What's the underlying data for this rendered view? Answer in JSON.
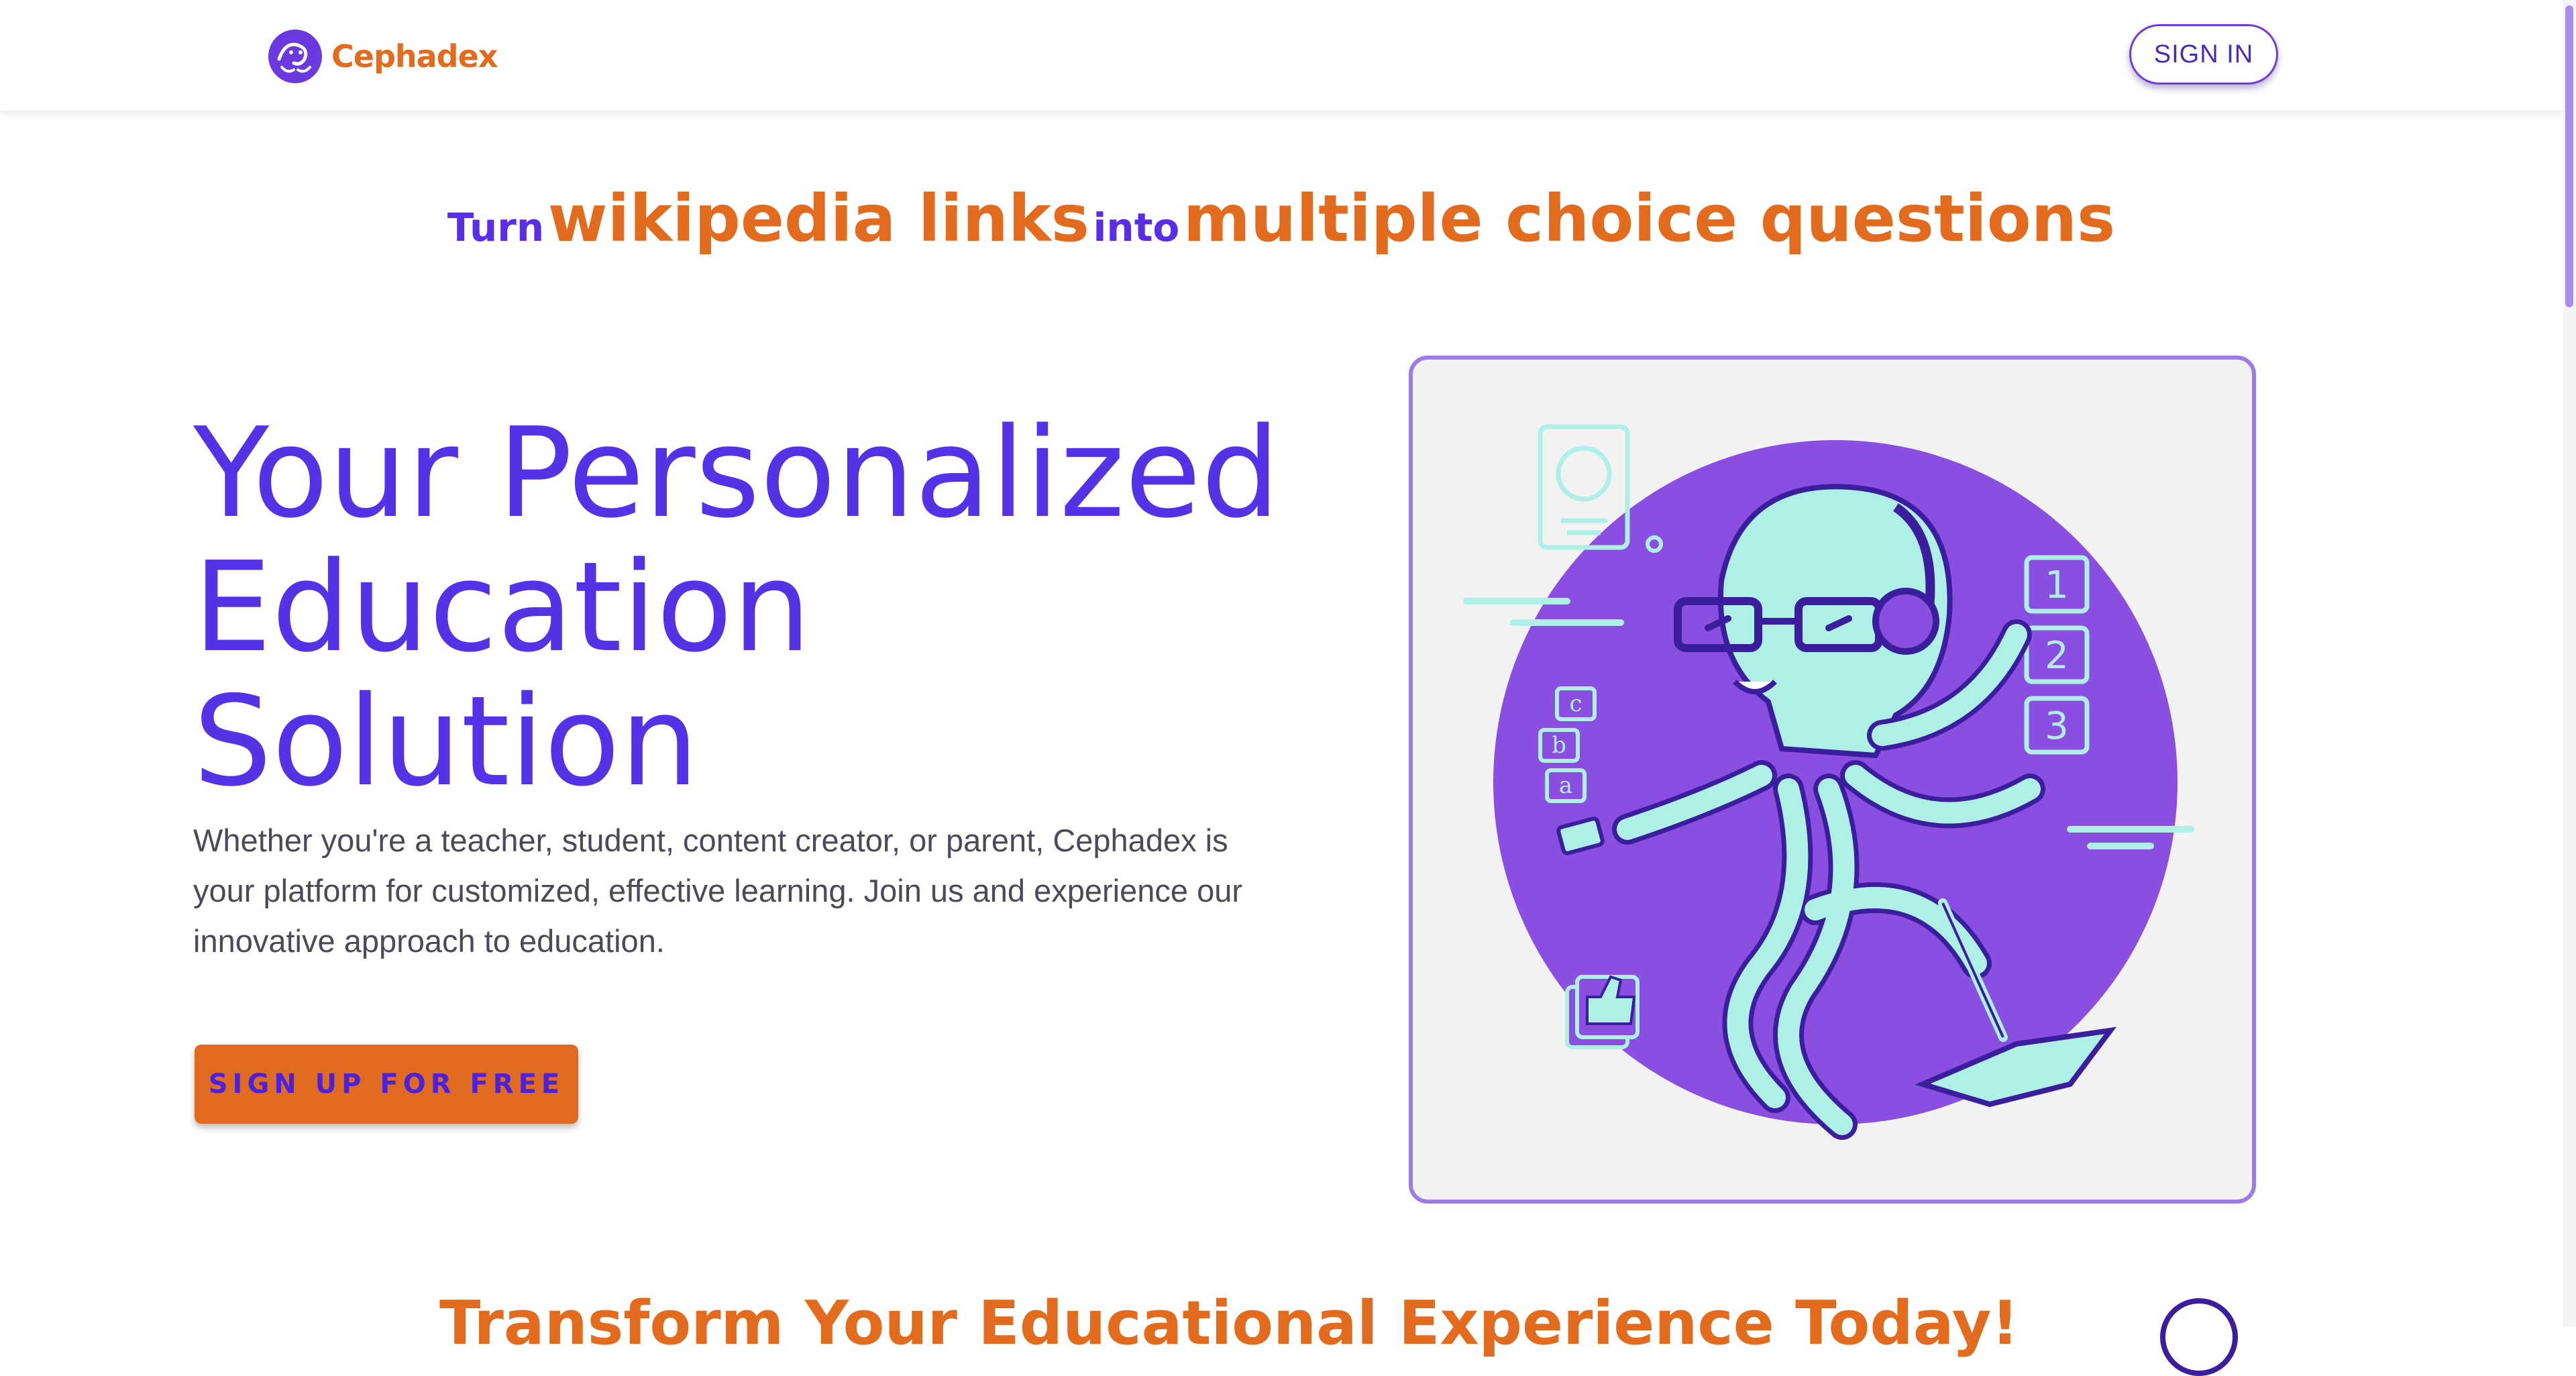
{
  "header": {
    "brand": "Cephadex",
    "sign_in": "SIGN IN"
  },
  "tagline": {
    "part1": "Turn",
    "part2": "wikipedia links",
    "part3": "into",
    "part4": "multiple choice questions"
  },
  "hero": {
    "title_line1": "Your Personalized",
    "title_line2": "Education",
    "title_line3": "Solution",
    "description": "Whether you're a teacher, student, content creator, or parent, Cephadex is your platform for customized, effective learning. Join us and experience our innovative approach to education.",
    "cta": "SIGN UP FOR FREE"
  },
  "illustration": {
    "numbers": [
      "1",
      "2",
      "3"
    ],
    "letters": [
      "c",
      "b",
      "a"
    ]
  },
  "section2": {
    "heading": "Transform Your Educational Experience Today!"
  },
  "colors": {
    "brand_purple": "#5432e6",
    "brand_orange": "#e26b1e",
    "illustration_purple": "#8a4fe0",
    "illustration_mint": "#aef0e6"
  }
}
